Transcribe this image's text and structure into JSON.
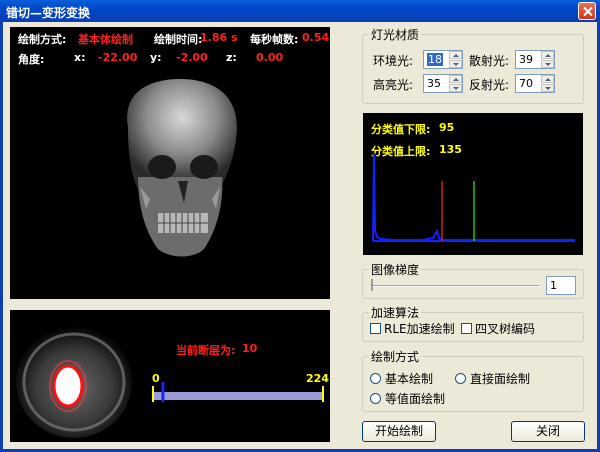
{
  "window": {
    "title": "错切—变形变换"
  },
  "view3d": {
    "draw_mode_label": "绘制方式:",
    "draw_mode_value": "基本体绘制",
    "draw_time_label": "绘制时间:",
    "draw_time_value": "1.86 s",
    "fps_label": "每秒帧数:",
    "fps_value": "0.54",
    "angle_label": "角度:",
    "x_label": "x:",
    "x_value": "-22.00",
    "y_label": "y:",
    "y_value": "-2.00",
    "z_label": "z:",
    "z_value": "0.00"
  },
  "slice_view": {
    "current_layer_label": "当前断层为:",
    "current_layer_value": "10",
    "slider_min": "0",
    "slider_max": "224",
    "slider_value": 10
  },
  "lighting": {
    "legend": "灯光材质",
    "ambient_label": "环境光:",
    "ambient_value": "18",
    "diffuse_label": "散射光:",
    "diffuse_value": "39",
    "highlight_label": "高亮光:",
    "highlight_value": "35",
    "reflect_label": "反射光:",
    "reflect_value": "70"
  },
  "histogram": {
    "lower_label": "分类值下限:",
    "lower_value": "95",
    "upper_label": "分类值上限:",
    "upper_value": "135"
  },
  "gradient": {
    "legend": "图像梯度",
    "value": "1"
  },
  "acceleration": {
    "legend": "加速算法",
    "rle_label": "RLE加速绘制",
    "quadtree_label": "四叉树编码"
  },
  "render_mode": {
    "legend": "绘制方式",
    "basic_label": "基本绘制",
    "direct_label": "直接面绘制",
    "isosurface_label": "等值面绘制"
  },
  "buttons": {
    "start_label": "开始绘制",
    "close_label": "关闭"
  },
  "colors": {
    "titlebar": "#0046c8",
    "info_red": "#ff2020",
    "histogram_yellow": "#ffff00",
    "histogram_blue": "#1020ff"
  }
}
